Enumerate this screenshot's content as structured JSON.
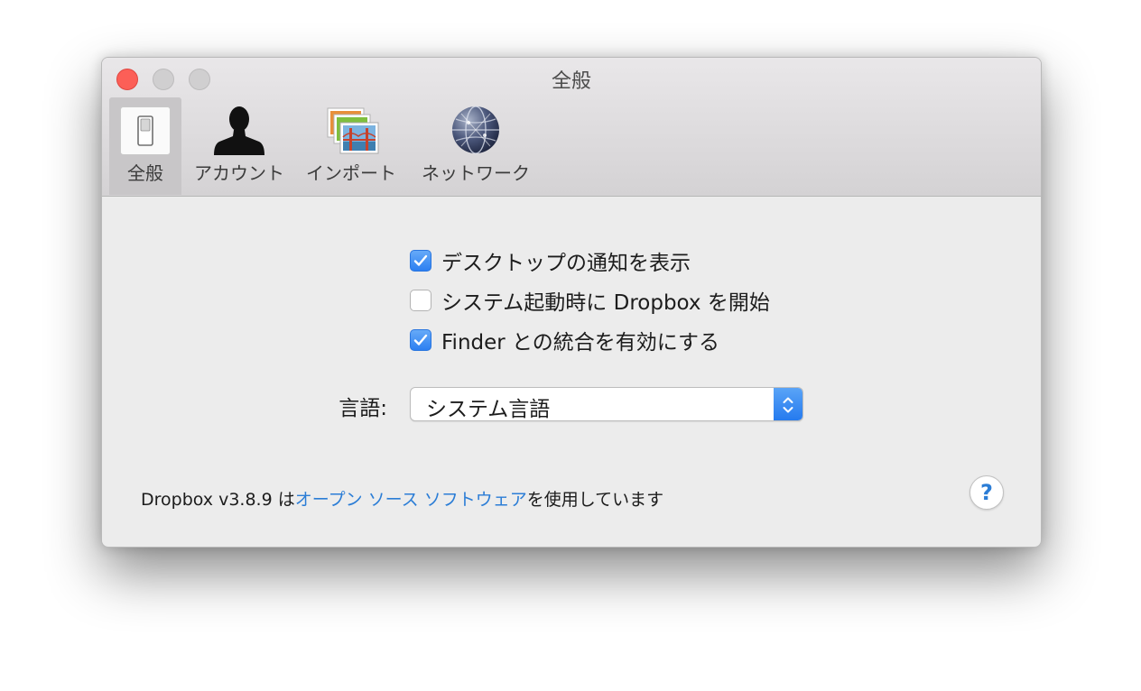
{
  "window": {
    "title": "全般"
  },
  "toolbar": {
    "tabs": [
      {
        "label": "全般",
        "icon": "general-switch-icon",
        "selected": true
      },
      {
        "label": "アカウント",
        "icon": "account-silhouette-icon",
        "selected": false
      },
      {
        "label": "インポート",
        "icon": "import-photos-icon",
        "selected": false
      },
      {
        "label": "ネットワーク",
        "icon": "network-globe-icon",
        "selected": false
      }
    ]
  },
  "settings": {
    "options": [
      {
        "label": "デスクトップの通知を表示",
        "checked": true
      },
      {
        "label": "システム起動時に Dropbox を開始",
        "checked": false
      },
      {
        "label": "Finder との統合を有効にする",
        "checked": true
      }
    ],
    "language": {
      "label": "言語:",
      "value": "システム言語"
    }
  },
  "footer": {
    "prefix": "Dropbox v3.8.9 は",
    "link": "オープン ソース ソフトウェア",
    "suffix": "を使用しています",
    "help_label": "?"
  },
  "colors": {
    "accent": "#2b7dd6",
    "checkbox_blue": "#3d8ff5",
    "close_red": "#fc5f57"
  }
}
